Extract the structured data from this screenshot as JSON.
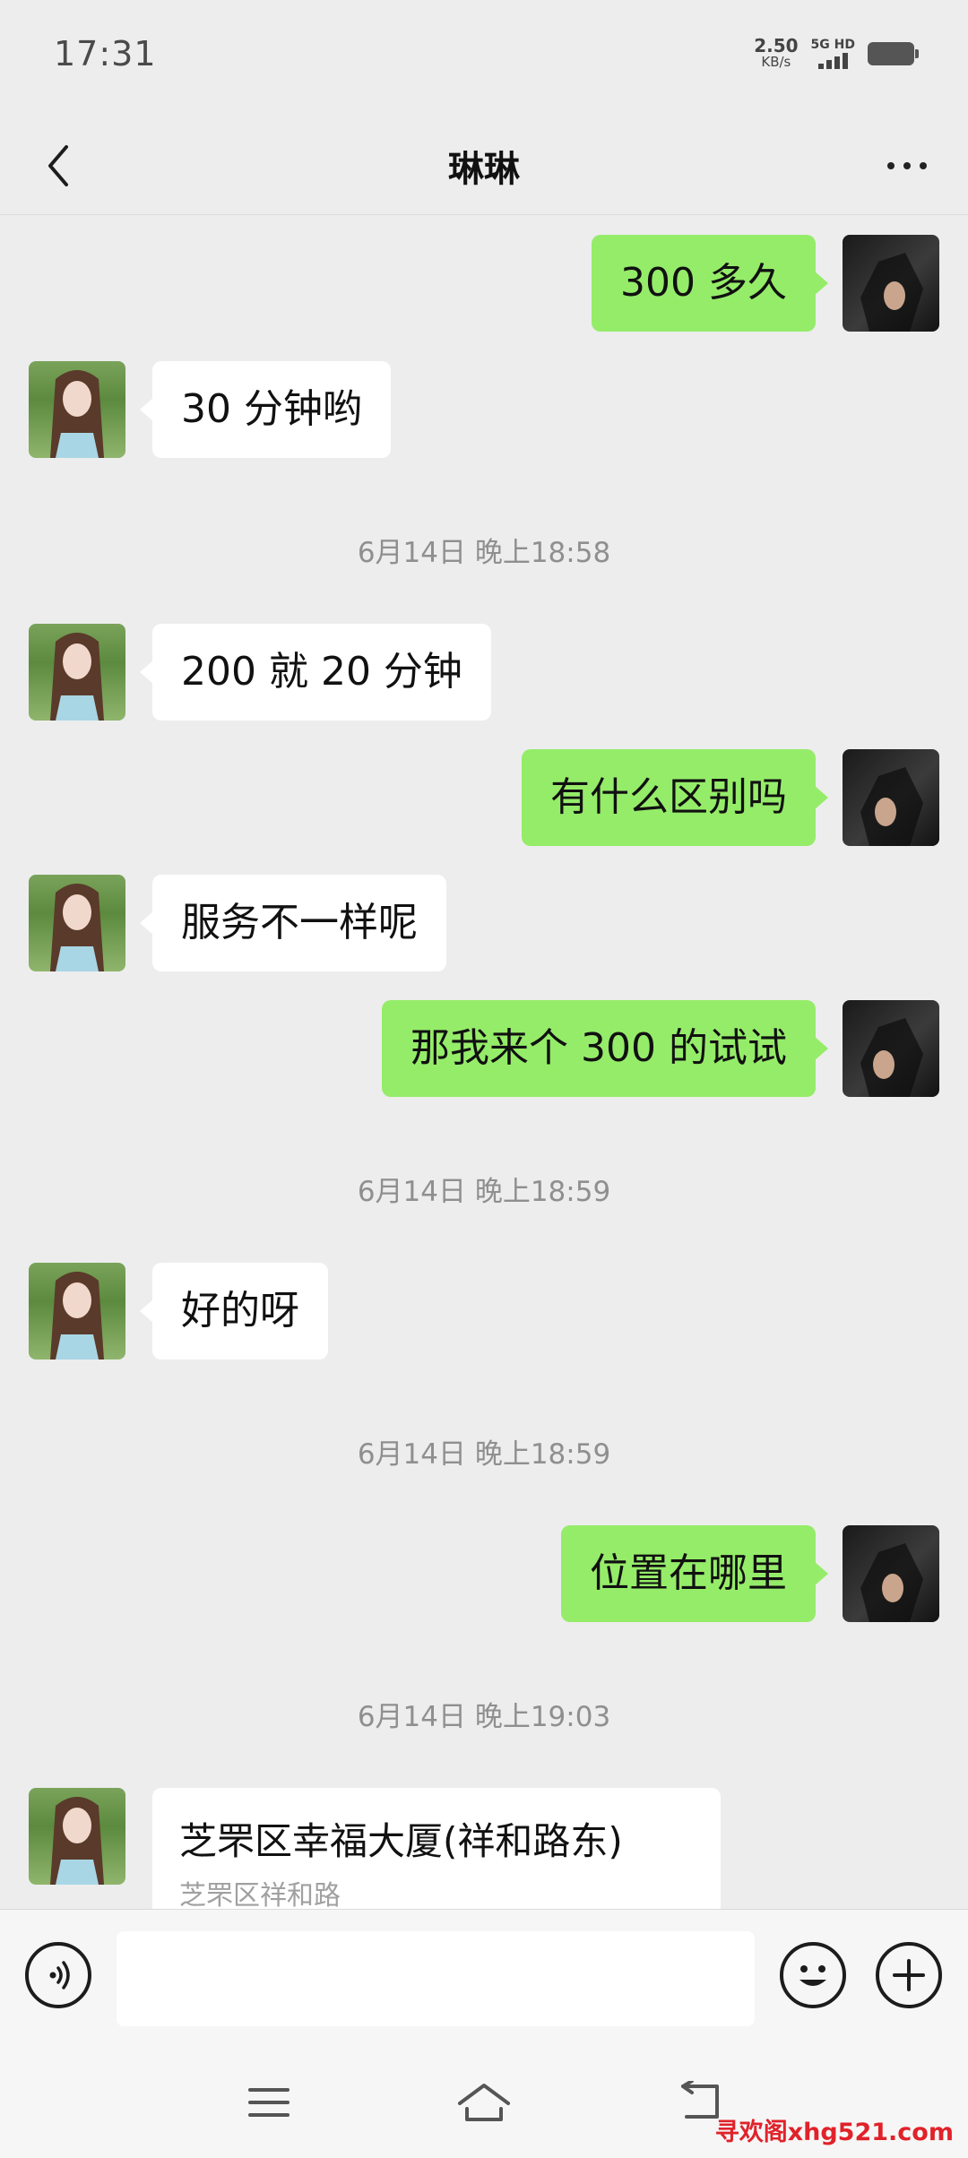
{
  "status_bar": {
    "time": "17:31",
    "net_speed_value": "2.50",
    "net_speed_unit": "KB/s",
    "network_label": "5G HD"
  },
  "nav": {
    "title": "琳琳",
    "back_icon": "chevron-left-icon",
    "more_icon": "more-dots-icon"
  },
  "messages": [
    {
      "from": "me",
      "text": "300 多久"
    },
    {
      "from": "her",
      "text": "30 分钟哟"
    },
    {
      "timestamp": "6月14日 晚上18:58"
    },
    {
      "from": "her",
      "text": "200 就 20 分钟"
    },
    {
      "from": "me",
      "text": "有什么区别吗"
    },
    {
      "from": "her",
      "text": "服务不一样呢"
    },
    {
      "from": "me",
      "text": "那我来个 300 的试试"
    },
    {
      "timestamp": "6月14日 晚上18:59"
    },
    {
      "from": "her",
      "text": "好的呀"
    },
    {
      "timestamp": "6月14日 晚上18:59"
    },
    {
      "from": "me",
      "text": "位置在哪里"
    },
    {
      "timestamp": "6月14日 晚上19:03"
    },
    {
      "from": "her",
      "type": "location",
      "title": "芝罘区幸福大厦(祥和路东)",
      "subtitle": "芝罘区祥和路"
    }
  ],
  "input_bar": {
    "voice_icon": "voice-icon",
    "emoji_icon": "emoji-icon",
    "plus_icon": "plus-icon",
    "input_value": ""
  },
  "system_nav": {
    "menu_icon": "menu-icon",
    "home_icon": "home-icon",
    "back_icon": "back-icon"
  },
  "watermark": "寻欢阁xhg521.com",
  "colors": {
    "background": "#ededed",
    "my_bubble": "#95ec69",
    "her_bubble": "#ffffff",
    "watermark": "#e0222a"
  }
}
